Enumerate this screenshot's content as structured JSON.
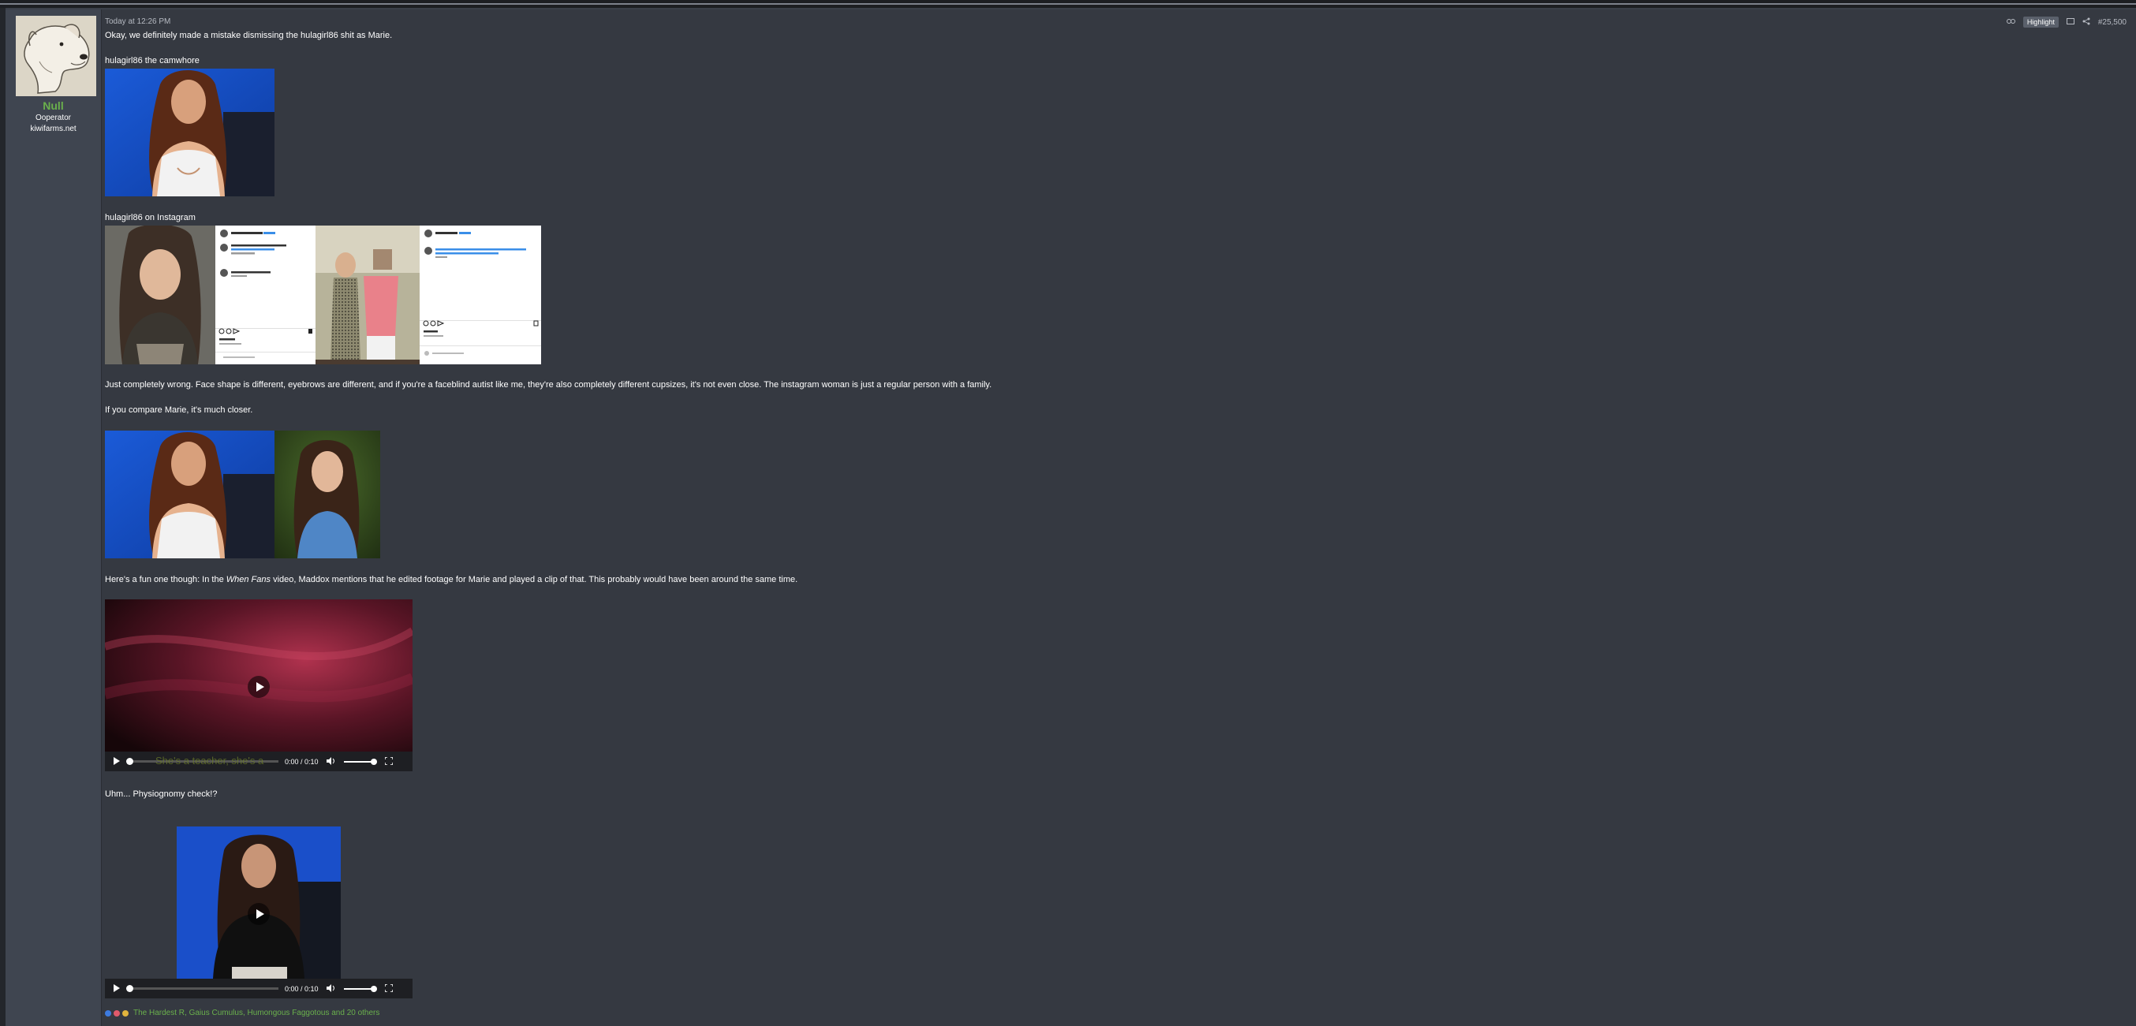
{
  "user": {
    "name": "Null",
    "title": "Ooperator",
    "site": "kiwifarms.net"
  },
  "post": {
    "date": "Today at 12:26 PM",
    "number": "#25,500",
    "highlight_label": "Highlight"
  },
  "content": {
    "p1": "Okay, we definitely made a mistake dismissing the hulagirl86 shit as Marie.",
    "p2": "hulagirl86 the camwhore",
    "p3": "hulagirl86 on Instagram",
    "p4": "Just completely wrong. Face shape is different, eyebrows are different, and if you're a faceblind autist like me, they're also completely different cupsizes, it's not even close. The instagram woman is just a regular person with a family.",
    "p5": "If you compare Marie, it's much closer.",
    "p6_a": "Here's a fun one though: In the ",
    "p6_em": "When Fans",
    "p6_b": " video, Maddox mentions that he edited footage for Marie and played a clip of that. This probably would have been around the same time.",
    "p7": "Uhm... Physiognomy check!?"
  },
  "video1": {
    "time": "0:00 / 0:10",
    "caption": "She's a teacher, she's a"
  },
  "video2": {
    "time": "0:00 / 0:10"
  },
  "reactions": {
    "text": "The Hardest R, Gaius Cumulus, Humongous Faggotous and 20 others"
  },
  "icons": {
    "link": "link-icon",
    "bookmark": "bookmark-icon",
    "share": "share-icon",
    "play": "play-icon",
    "volume": "volume-icon",
    "fullscreen": "fullscreen-icon",
    "like": "like-icon",
    "reply": "reply-icon",
    "send": "send-icon"
  },
  "colors": {
    "background": "#3a3f49",
    "username": "#6ab04c",
    "text": "#ffffff"
  }
}
